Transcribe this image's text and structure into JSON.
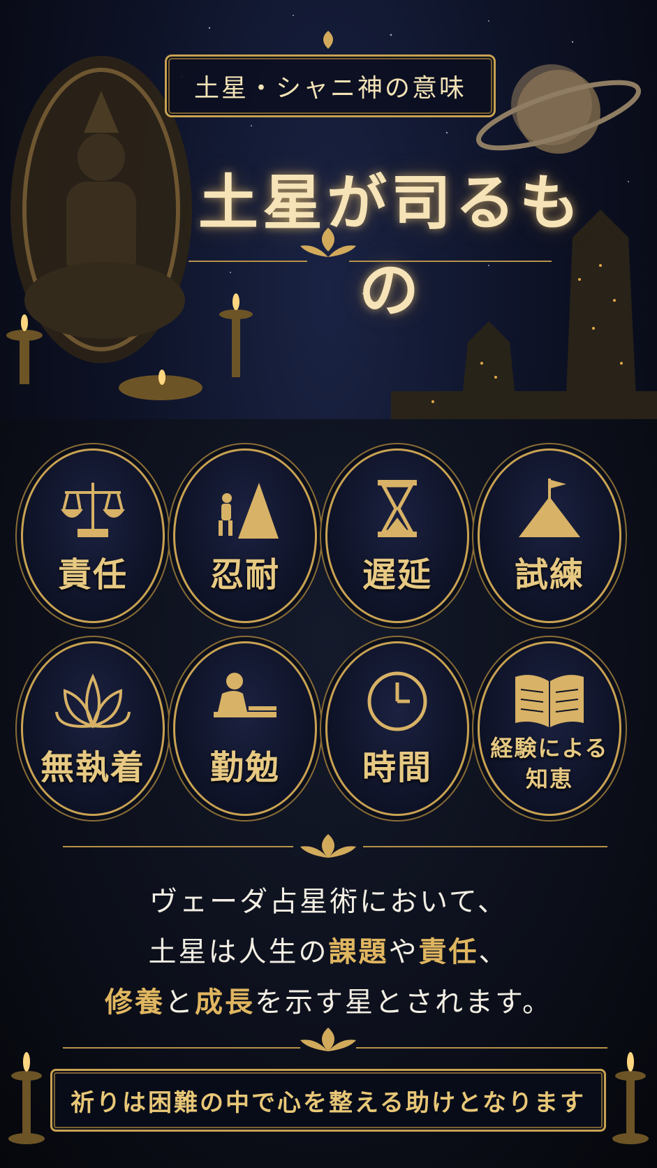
{
  "header": {
    "subtitle_tag": "土星・シャニ神の意味",
    "title": "土星が司るもの"
  },
  "traits": [
    {
      "label": "責任",
      "icon": "scales-icon"
    },
    {
      "label": "忍耐",
      "icon": "climber-icon"
    },
    {
      "label": "遅延",
      "icon": "hourglass-icon"
    },
    {
      "label": "試練",
      "icon": "mountain-flag-icon"
    },
    {
      "label": "無執着",
      "icon": "lotus-icon"
    },
    {
      "label": "勤勉",
      "icon": "worker-icon"
    },
    {
      "label": "時間",
      "icon": "clock-icon"
    },
    {
      "label": "経験による知恵",
      "label_line1": "経験による",
      "label_line2": "知恵",
      "icon": "open-book-icon"
    }
  ],
  "description": {
    "line1": "ヴェーダ占星術において、",
    "line2_a": "土星は人生の",
    "line2_b": "課題",
    "line2_c": "や",
    "line2_d": "責任",
    "line2_e": "、",
    "line3_a": "修養",
    "line3_b": "と",
    "line3_c": "成長",
    "line3_d": "を示す星とされます。"
  },
  "footer": {
    "text": "祈りは困難の中で心を整える助けとなります"
  },
  "colors": {
    "gold": "#c9a252",
    "gold_text": "#e7c983",
    "background": "#0b0f1f"
  }
}
